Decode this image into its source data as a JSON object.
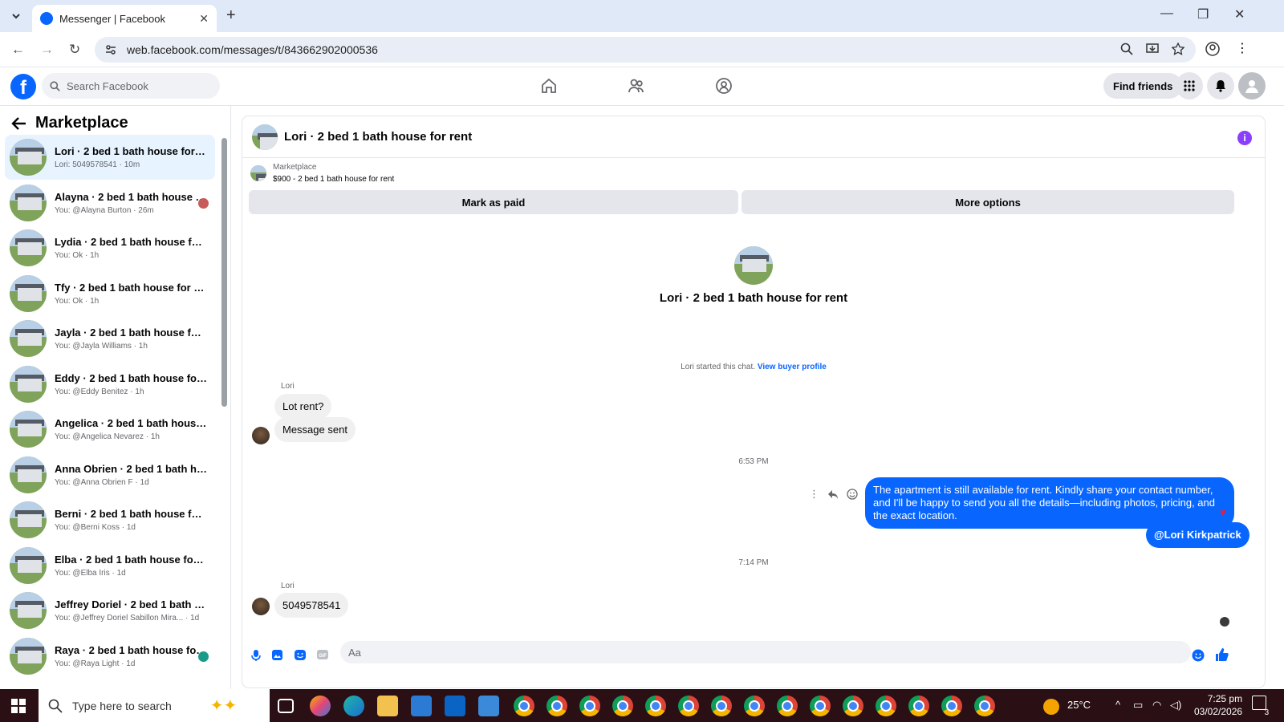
{
  "browser": {
    "tab_title": "Messenger | Facebook",
    "url": "web.facebook.com/messages/t/843662902000536"
  },
  "fb": {
    "search_placeholder": "Search Facebook",
    "find_friends": "Find friends"
  },
  "sidebar": {
    "title": "Marketplace",
    "conversations": [
      {
        "name": "Lori · 2 bed 1 bath house for rent",
        "sub": "Lori: 5049578541 · 10m",
        "active": true
      },
      {
        "name": "Alayna · 2 bed 1 bath house f...",
        "sub": "You: @Alayna Burton · 26m"
      },
      {
        "name": "Lydia · 2 bed 1 bath house for re...",
        "sub": "You: Ok · 1h"
      },
      {
        "name": "Tfy · 2 bed 1 bath house for rent",
        "sub": "You: Ok · 1h"
      },
      {
        "name": "Jayla · 2 bed 1 bath house for rent",
        "sub": "You: @Jayla Williams · 1h"
      },
      {
        "name": "Eddy · 2 bed 1 bath house for re...",
        "sub": "You: @Eddy Benitez · 1h"
      },
      {
        "name": "Angelica · 2 bed 1 bath house f...",
        "sub": "You: @Angelica Nevarez · 1h"
      },
      {
        "name": "Anna Obrien · 2 bed 1 bath hou...",
        "sub": "You: @Anna Obrien F · 1d"
      },
      {
        "name": "Berni · 2 bed 1 bath house for re...",
        "sub": "You: @Berni Koss · 1d"
      },
      {
        "name": "Elba · 2 bed 1 bath house for rent",
        "sub": "You: @Elba Iris · 1d"
      },
      {
        "name": "Jeffrey Doriel · 2 bed 1 bath hou...",
        "sub": "You: @Jeffrey Doriel Sabillon Mira... · 1d"
      },
      {
        "name": "Raya · 2 bed 1 bath house for ...",
        "sub": "You: @Raya Light · 1d"
      }
    ]
  },
  "chat": {
    "title": "Lori · 2 bed 1 bath house for rent",
    "marketplace_label": "Marketplace",
    "listing": "$900 - 2 bed 1 bath house for rent",
    "mark_paid": "Mark as paid",
    "more_options": "More options",
    "intro_title": "Lori · 2 bed 1 bath house for rent",
    "started_text": "Lori started this chat.",
    "view_buyer": "View buyer profile",
    "sender_name": "Lori",
    "msg1": "Lot rent?",
    "msg2": "Message sent",
    "time1": "6:53 PM",
    "out_msg": "The apartment is still available for rent. Kindly share your contact number, and I'll be happy to send you all the details—including photos, pricing, and the exact location.",
    "mention": "@Lori Kirkpatrick",
    "time2": "7:14 PM",
    "msg3": "5049578541",
    "composer_placeholder": "Aa"
  },
  "taskbar": {
    "search": "Type here to search",
    "temp": "25°C",
    "time": "7:25 pm",
    "date": "03/02/2026",
    "notif_count": "3"
  },
  "colors": {
    "fb_blue": "#0866ff",
    "taskbar": "#2a0f14"
  }
}
